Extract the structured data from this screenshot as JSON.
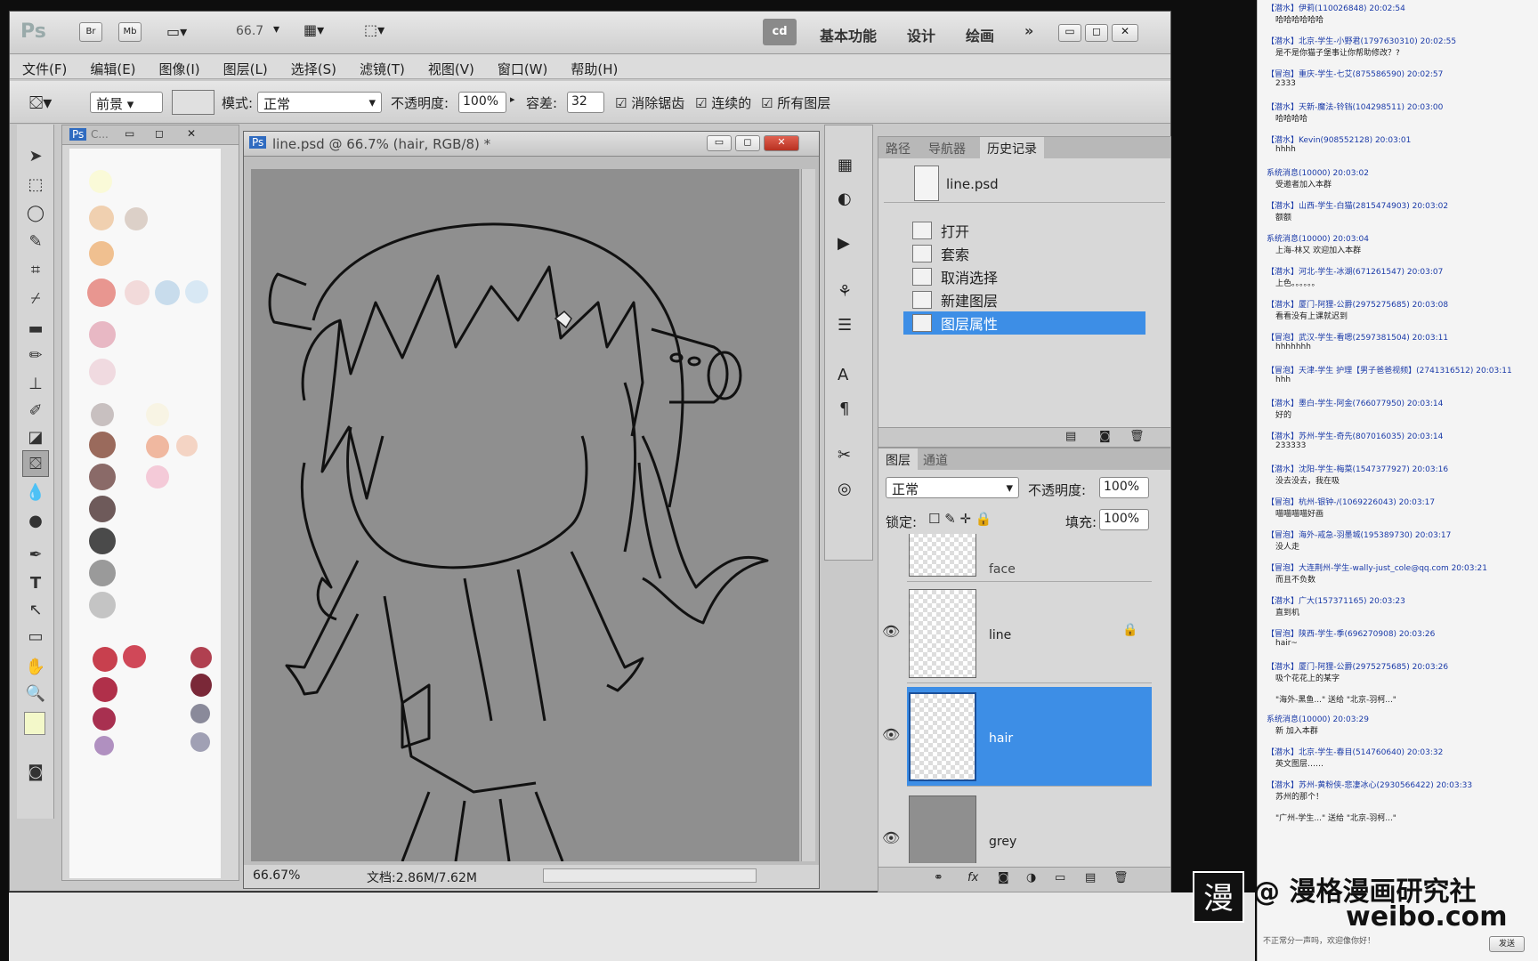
{
  "app": {
    "logo": "Ps",
    "title_buttons": [
      "Br",
      "Mb"
    ],
    "zoom_label": "66.7",
    "workspace_badge": "cd",
    "workspaces": [
      "基本功能",
      "设计",
      "绘画"
    ],
    "more": "»"
  },
  "menu": [
    "文件(F)",
    "编辑(E)",
    "图像(I)",
    "图层(L)",
    "选择(S)",
    "滤镜(T)",
    "视图(V)",
    "窗口(W)",
    "帮助(H)"
  ],
  "options": {
    "fill_source": "前景",
    "mode_label": "模式:",
    "mode_value": "正常",
    "opacity_label": "不透明度:",
    "opacity_value": "100%",
    "tolerance_label": "容差:",
    "tolerance_value": "32",
    "antialias": "消除锯齿",
    "contiguous": "连续的",
    "all_layers": "所有图层"
  },
  "swatch_panel": {
    "title": "C..."
  },
  "document": {
    "title": "line.psd @ 66.7% (hair, RGB/8) *",
    "zoom": "66.67%",
    "doc_info": "文档:2.86M/7.62M"
  },
  "history_panel": {
    "tabs": [
      "路径",
      "导航器",
      "历史记录"
    ],
    "active_tab": "历史记录",
    "snapshot": "line.psd",
    "items": [
      "打开",
      "套索",
      "取消选择",
      "新建图层",
      "图层属性"
    ],
    "selected": "图层属性"
  },
  "layers_panel": {
    "tabs": [
      "图层",
      "通道"
    ],
    "blend_mode": "正常",
    "opacity_label": "不透明度:",
    "opacity_value": "100%",
    "lock_label": "锁定:",
    "fill_label": "填充:",
    "fill_value": "100%",
    "layers": [
      "face",
      "line",
      "hair",
      "grey"
    ],
    "selected": "hair"
  },
  "chat": {
    "messages": [
      {
        "header": "【潜水】伊莉(110026848) 20:02:54",
        "body": "哈哈哈哈哈哈"
      },
      {
        "header": "【潜水】北京-学生-小野君(1797630310) 20:02:55",
        "body": "是不是你猫子堡事让你帮助修改？?"
      },
      {
        "header": "【冒泡】重庆-学生-七艾(875586590) 20:02:57",
        "body": "2333"
      },
      {
        "header": "【潜水】天新-魔法-铃铛(104298511) 20:03:00",
        "body": "哈哈哈哈"
      },
      {
        "header": "【潜水】Kevin(908552128) 20:03:01",
        "body": "hhhh"
      },
      {
        "header": "系统消息(10000) 20:03:02",
        "body": "受邀者加入本群"
      },
      {
        "header": "【潜水】山西-学生-白猫(2815474903) 20:03:02",
        "body": "额额"
      },
      {
        "header": "系统消息(10000) 20:03:04",
        "body": "上海-林又 欢迎加入本群"
      },
      {
        "header": "【潜水】河北-学生-冰湖(671261547) 20:03:07",
        "body": "上色。。。。。。"
      },
      {
        "header": "【潜水】厦门-阿狸-公爵(2975275685) 20:03:08",
        "body": "看看没有上课就迟到"
      },
      {
        "header": "【冒泡】武汉-学生-看嗯(2597381504) 20:03:11",
        "body": "hhhhhhh"
      },
      {
        "header": "【冒泡】天津-学生 护理【男子爸爸视频】(2741316512) 20:03:11",
        "body": "hhh"
      },
      {
        "header": "【潜水】墨白-学生-阿金(766077950) 20:03:14",
        "body": "好的"
      },
      {
        "header": "【潜水】苏州-学生-奇先(807016035) 20:03:14",
        "body": "233333"
      },
      {
        "header": "【潜水】沈阳-学生-梅菜(1547377927) 20:03:16",
        "body": "没去没去，我在吸"
      },
      {
        "header": "【冒泡】杭州-银钟-/(1069226043) 20:03:17",
        "body": "喵喵喵喵好画"
      },
      {
        "header": "【冒泡】海外-戒急-羽墨城(195389730) 20:03:17",
        "body": "没人走"
      },
      {
        "header": "【冒泡】大连荆州-学生-wally-just_cole@qq.com 20:03:21",
        "body": "而且不负数"
      },
      {
        "header": "【潜水】广大(157371165) 20:03:23",
        "body": "直到机"
      },
      {
        "header": "【冒泡】陕西-学生-季(696270908) 20:03:26",
        "body": "hair~"
      },
      {
        "header": "【潜水】厦门-阿狸-公爵(2975275685) 20:03:26",
        "body": "吸个花花上的某字"
      },
      {
        "header": "",
        "body": "\"海外-黑鱼...\" 送给 \"北京-羽柯...\""
      },
      {
        "header": "系统消息(10000) 20:03:29",
        "body": "新 加入本群"
      },
      {
        "header": "【潜水】北京-学生-春目(514760640) 20:03:32",
        "body": "英文图层……"
      },
      {
        "header": "【潜水】苏州-黄粉侠-悲凄冰心(2930566422) 20:03:33",
        "body": "苏州的那个！"
      },
      {
        "header": "",
        "body": "\"广州-学生...\" 送给 \"北京-羽柯...\""
      }
    ],
    "footer": "不正常分一声吗，欢迎像你好！",
    "send": "发送"
  },
  "watermark": {
    "line1": "@ 漫格漫画研究社",
    "line2": "weibo.com",
    "logo": "漫"
  }
}
